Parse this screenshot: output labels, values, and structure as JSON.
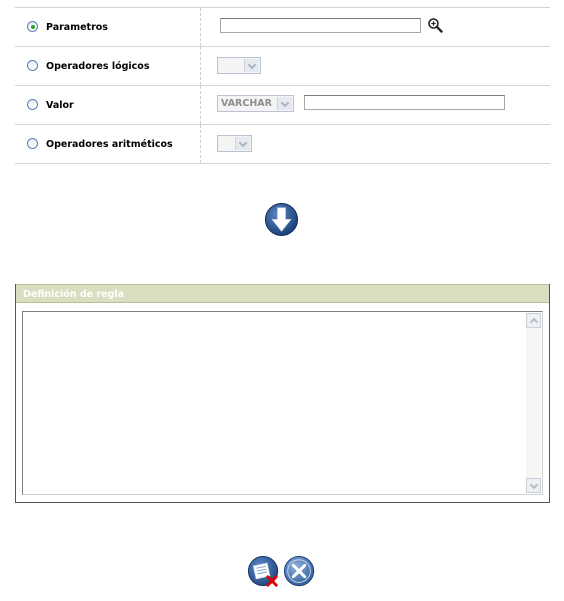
{
  "form": {
    "rows": [
      {
        "label": "Parametros",
        "checked": true
      },
      {
        "label": "Operadores lógicos",
        "checked": false
      },
      {
        "label": "Valor",
        "checked": false
      },
      {
        "label": "Operadores aritméticos",
        "checked": false
      }
    ],
    "parametros_value": "",
    "valor_type": "VARCHAR",
    "valor_value": "",
    "logical_operator_value": "",
    "arithmetic_operator_value": ""
  },
  "panel": {
    "title": "Definición de regla",
    "content": ""
  },
  "icons": {
    "zoom": "magnifier-zoom-icon",
    "down": "arrow-down-icon",
    "clear": "clear-rule-icon",
    "cancel": "cancel-icon"
  },
  "colors": {
    "panel_header": "#d8dfc0",
    "radio_selected": "#29a329",
    "button_blue": "#2f5c98"
  }
}
